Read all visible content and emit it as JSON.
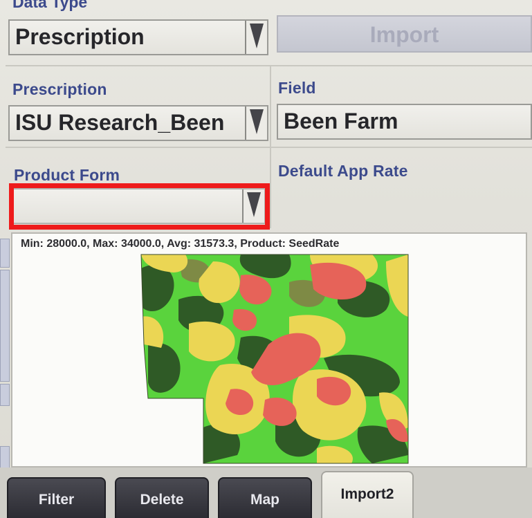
{
  "header": {
    "data_type_label": "Data Type"
  },
  "data_type": {
    "value": "Prescription"
  },
  "import_button": {
    "label": "Import"
  },
  "prescription": {
    "label": "Prescription",
    "value": "ISU Research_Been"
  },
  "field": {
    "label": "Field",
    "value": "Been Farm"
  },
  "product_form": {
    "label": "Product Form",
    "value": ""
  },
  "default_app_rate": {
    "label": "Default App Rate"
  },
  "map": {
    "stats": "Min: 28000.0, Max: 34000.0, Avg: 31573.3, Product: SeedRate",
    "colors": {
      "low": "#2f5a26",
      "mid_low": "#5ad33d",
      "mid": "#7e8a45",
      "mid_high": "#ebd654",
      "high": "#e66359"
    }
  },
  "tabs": [
    {
      "label": "Filter",
      "active": false
    },
    {
      "label": "Delete",
      "active": false
    },
    {
      "label": "Map",
      "active": false
    },
    {
      "label": "Import2",
      "active": true
    }
  ]
}
